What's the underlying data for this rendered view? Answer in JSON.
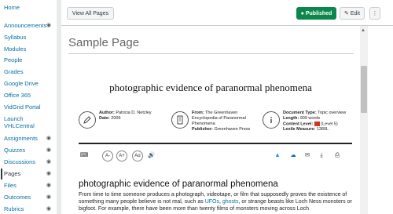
{
  "nav": {
    "items": [
      {
        "label": "Home"
      },
      {
        "label": "Announcements"
      },
      {
        "label": "Syllabus"
      },
      {
        "label": "Modules"
      },
      {
        "label": "People"
      },
      {
        "label": "Grades"
      },
      {
        "label": "Google Drive"
      },
      {
        "label": "Office 365"
      },
      {
        "label": "VidGrid Portal"
      },
      {
        "label": "Launch"
      },
      {
        "label": "VHLCentral"
      },
      {
        "label": "Assignments"
      },
      {
        "label": "Quizzes"
      },
      {
        "label": "Discussions"
      },
      {
        "label": "Pages"
      },
      {
        "label": "Files"
      },
      {
        "label": "Outcomes"
      },
      {
        "label": "Rubrics"
      }
    ]
  },
  "toolbar": {
    "view_all": "View All Pages",
    "published": "Published",
    "edit": "Edit",
    "more": "⋮"
  },
  "page_title": "Sample Page",
  "document": {
    "title": "photographic evidence of paranormal phenomena",
    "author_label": "Author:",
    "author": "Patricia D. Netzley",
    "date_label": "Date:",
    "date": "2006",
    "from_label": "From:",
    "from": "The Greenhaven Encyclopedia of Paranormal Phenomena",
    "publisher_label": "Publisher:",
    "publisher": "Greenhaven Press",
    "doc_type_label": "Document Type:",
    "doc_type": "Topic overview",
    "length_label": "Length:",
    "length": "909 words",
    "content_level_label": "Content Level:",
    "content_level": "(Level 5)",
    "lexile_label": "Lexile Measure:",
    "lexile": "1380L"
  },
  "tools": [
    "A-",
    "A+",
    "Aα",
    "🔊"
  ],
  "article": {
    "heading": "photographic evidence of paranormal phenomena",
    "body_1": "From time to time someone produces a photograph, videotape, or film that supposedly proves the existence of something many people believe is not real, such as ",
    "link_ufos": "UFOs",
    "body_sep": ", ",
    "link_ghosts": "ghosts",
    "body_2": ", or strange beasts like Loch Ness monsters or bigfoot. For example, there have been more than twenty films of monsters moving across Loch"
  },
  "colors": {
    "link": "#0770a3",
    "published_green": "#0b874b"
  }
}
